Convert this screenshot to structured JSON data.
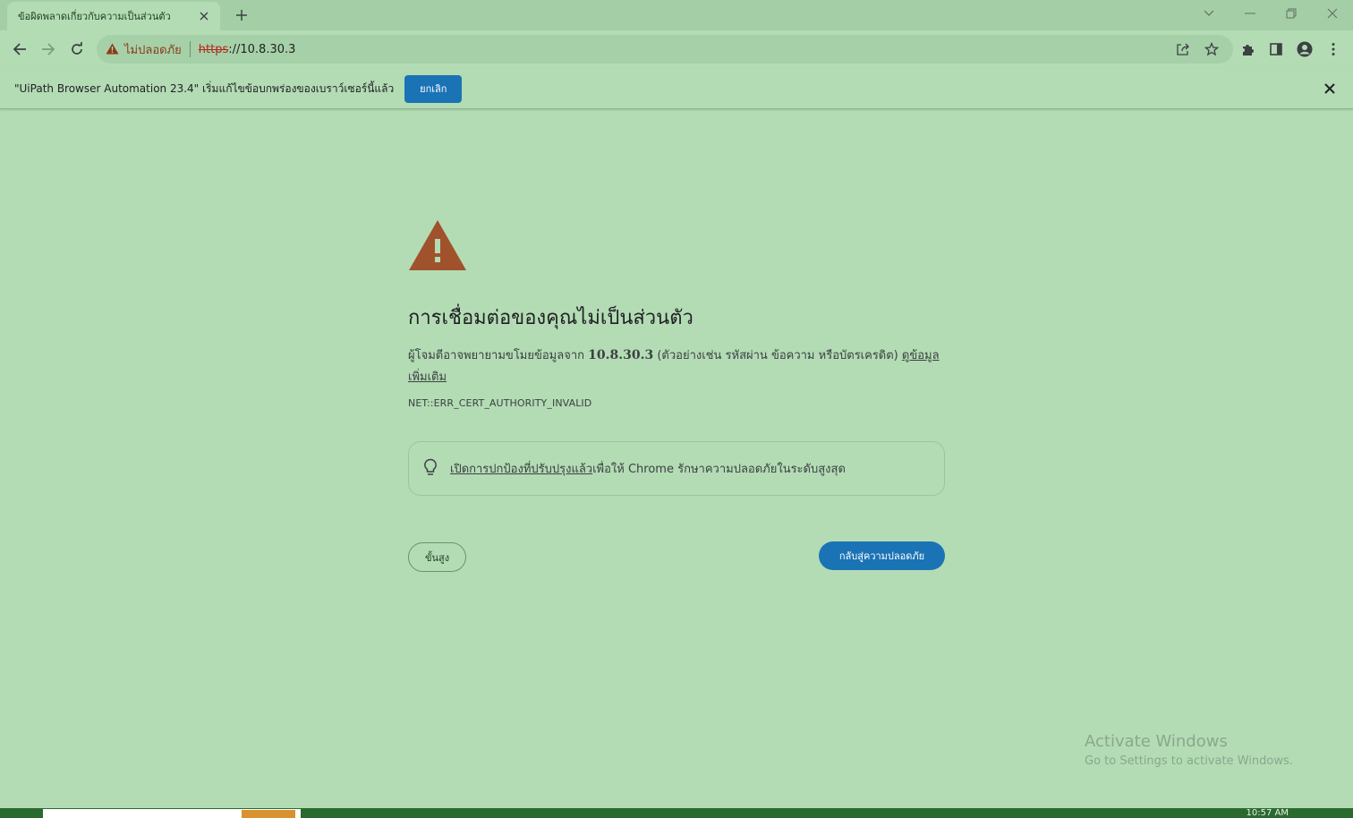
{
  "browser": {
    "tab": {
      "title": "ข้อผิดพลาดเกี่ยวกับความเป็นส่วนตัว"
    },
    "omnibox": {
      "security_label": "ไม่ปลอดภัย",
      "url_scheme": "https",
      "url_rest": "://10.8.30.3"
    }
  },
  "infobar": {
    "message": "\"UiPath Browser Automation 23.4\" เริ่มแก้ไขข้อบกพร่องของเบราว์เซอร์นี้แล้ว",
    "cancel_label": "ยกเลิก"
  },
  "interstitial": {
    "headline": "การเชื่อมต่อของคุณไม่เป็นส่วนตัว",
    "desc_prefix": "ผู้โจมตีอาจพยายามขโมยข้อมูลจาก ",
    "host": "10.8.30.3",
    "desc_suffix": " (ตัวอย่างเช่น รหัสผ่าน ข้อความ หรือบัตรเครดิต) ",
    "learn_more": "ดูข้อมูลเพิ่มเติม",
    "error_code": "NET::ERR_CERT_AUTHORITY_INVALID",
    "promo_link": "เปิดการปกป้องที่ปรับปรุงแล้ว",
    "promo_suffix": "เพื่อให้ Chrome รักษาความปลอดภัยในระดับสูงสุด",
    "advanced_label": "ขั้นสูง",
    "back_label": "กลับสู่ความปลอดภัย"
  },
  "watermark": {
    "line1": "Activate Windows",
    "line2": "Go to Settings to activate Windows."
  },
  "taskbar": {
    "clock": "10:57 AM"
  },
  "colors": {
    "page_bg": "#b3dcb4",
    "accent_button": "#1a73b5",
    "warning": "#a0522d"
  }
}
